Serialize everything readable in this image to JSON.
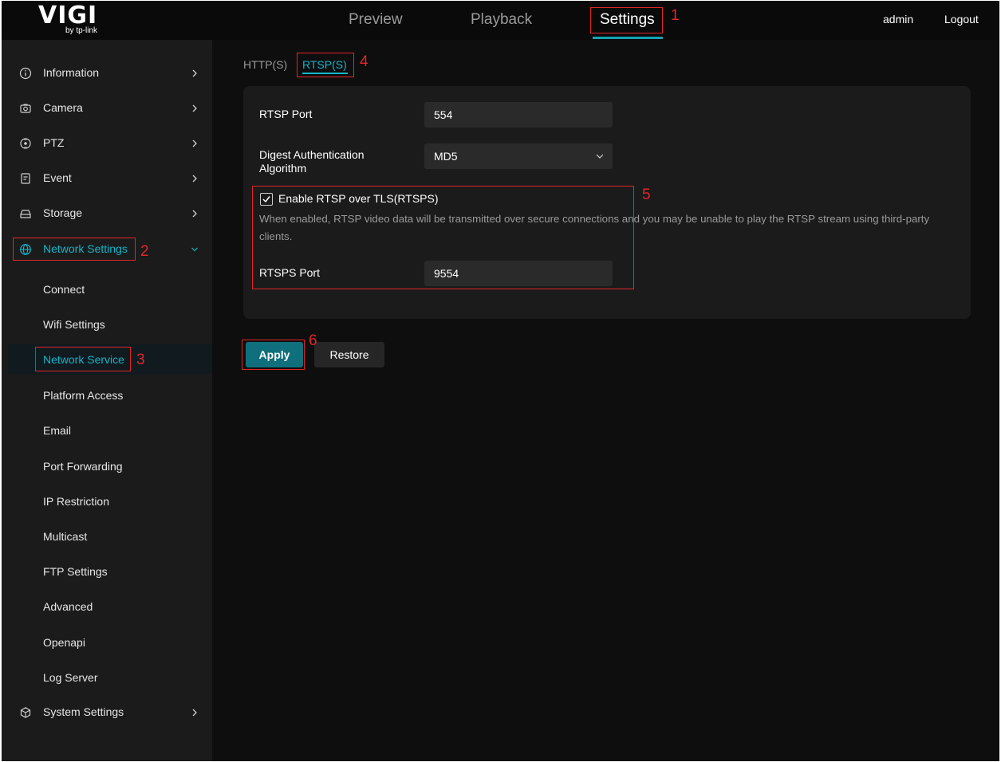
{
  "brand": {
    "logo": "VIGI",
    "sub": "by tp-link"
  },
  "nav": {
    "tabs": [
      {
        "label": "Preview"
      },
      {
        "label": "Playback"
      },
      {
        "label": "Settings"
      }
    ],
    "user": "admin",
    "logout": "Logout"
  },
  "sidebar": {
    "items": [
      {
        "label": "Information",
        "icon": "info-icon"
      },
      {
        "label": "Camera",
        "icon": "camera-icon"
      },
      {
        "label": "PTZ",
        "icon": "ptz-icon"
      },
      {
        "label": "Event",
        "icon": "event-icon"
      },
      {
        "label": "Storage",
        "icon": "storage-icon"
      },
      {
        "label": "Network Settings",
        "icon": "globe-icon"
      }
    ],
    "network_sub": [
      {
        "label": "Connect"
      },
      {
        "label": "Wifi Settings"
      },
      {
        "label": "Network Service"
      },
      {
        "label": "Platform Access"
      },
      {
        "label": "Email"
      },
      {
        "label": "Port Forwarding"
      },
      {
        "label": "IP Restriction"
      },
      {
        "label": "Multicast"
      },
      {
        "label": "FTP Settings"
      },
      {
        "label": "Advanced"
      },
      {
        "label": "Openapi"
      },
      {
        "label": "Log Server"
      }
    ],
    "system": {
      "label": "System Settings",
      "icon": "system-icon"
    }
  },
  "subtabs": [
    {
      "label": "HTTP(S)"
    },
    {
      "label": "RTSP(S)"
    }
  ],
  "form": {
    "rtsp_port": {
      "label": "RTSP Port",
      "value": "554"
    },
    "digest": {
      "label_line1": "Digest Authentication",
      "label_line2": "Algorithm",
      "value": "MD5"
    },
    "rtsps": {
      "label": "Enable RTSP over TLS(RTSPS)",
      "checked": true,
      "description": "When enabled, RTSP video data will be transmitted over secure connections and you may be unable to play the RTSP stream using third-party clients."
    },
    "rtsps_port": {
      "label": "RTSPS Port",
      "value": "9554"
    }
  },
  "buttons": {
    "apply": "Apply",
    "restore": "Restore"
  },
  "annotations": [
    "1",
    "2",
    "3",
    "4",
    "5",
    "6"
  ],
  "colors": {
    "accent": "#14b4c8",
    "apply": "#0f6f7c",
    "annotation": "#e0262b"
  }
}
